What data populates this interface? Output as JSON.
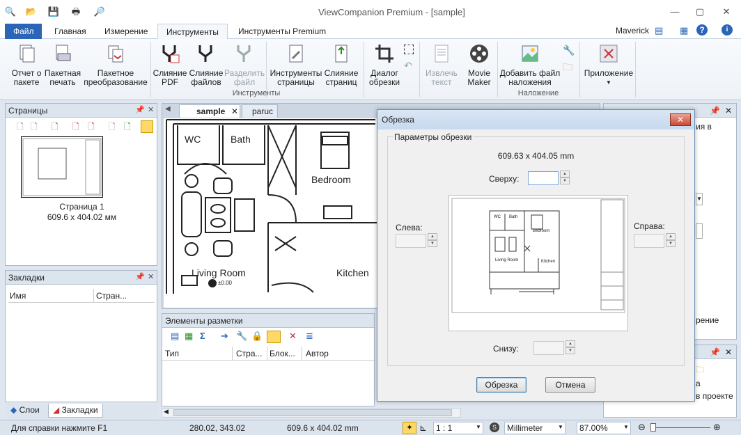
{
  "app": {
    "title": "ViewCompanion Premium - [sample]",
    "user": "Maverick"
  },
  "ribbon_tabs": [
    {
      "label": "Файл"
    },
    {
      "label": "Главная"
    },
    {
      "label": "Измерение"
    },
    {
      "label": "Инструменты"
    },
    {
      "label": "Инструменты Premium"
    }
  ],
  "ribbon": {
    "group1": {
      "buttons": [
        "Отчет о\nпакете",
        "Пакетная\nпечать",
        "Пакетное\nпреобразование",
        "Слияние\nPDF",
        "Слияние\nфайлов",
        "Разделить\nфайл",
        "Инструменты\nстраницы",
        "Слияние\nстраниц"
      ],
      "label": "Инструменты"
    },
    "crop_dialog_button": "Диалог\nобрезки",
    "extract_text_button": "Извлечь\nтекст",
    "movie_maker_button": "Movie\nMaker",
    "overlay": {
      "button": "Добавить файл\nналожения",
      "label": "Наложение"
    },
    "application_button": "Приложение"
  },
  "pages_panel": {
    "title": "Страницы",
    "page_label": "Страница 1",
    "page_size": "609.6 x 404.02 мм"
  },
  "bookmarks_panel": {
    "title": "Закладки",
    "col_name": "Имя",
    "col_page": "Стран..."
  },
  "bottom_tabs": {
    "layers": "Слои",
    "bookmarks": "Закладки"
  },
  "doc_tabs": {
    "sample": "sample",
    "ris": "paruc"
  },
  "drawing": {
    "wc": "WC",
    "bath": "Bath",
    "bedroom": "Bedroom",
    "living": "Living Room",
    "kitchen": "Kitchen",
    "level": "±0.00"
  },
  "markup_panel": {
    "title": "Элементы разметки",
    "cols": [
      "Тип",
      "Стра...",
      "Блок...",
      "Автор"
    ]
  },
  "right_panel": {
    "text1": "ия в",
    "text2": "рение",
    "text3": "а",
    "text4": "в проекте"
  },
  "dialog": {
    "title": "Обрезка",
    "group": "Параметры обрезки",
    "size": "609.63 x 404.05 mm",
    "top_label": "Сверху:",
    "left_label": "Слева:",
    "right_label": "Справа:",
    "bottom_label": "Снизу:",
    "ok": "Обрезка",
    "cancel": "Отмена",
    "preview": {
      "wc": "WC",
      "bath": "Bath",
      "bedroom": "Bedroom",
      "living": "Living Room",
      "kitchen": "Kitchen"
    }
  },
  "status": {
    "help": "Для справки нажмите F1",
    "coords": "280.02, 343.02",
    "size": "609.6 x 404.02 mm",
    "scale": "1 : 1",
    "unit": "Millimeter",
    "zoom": "87.00%"
  },
  "colors": {
    "accent": "#2a65b8",
    "selection": "#3c7fb1"
  }
}
